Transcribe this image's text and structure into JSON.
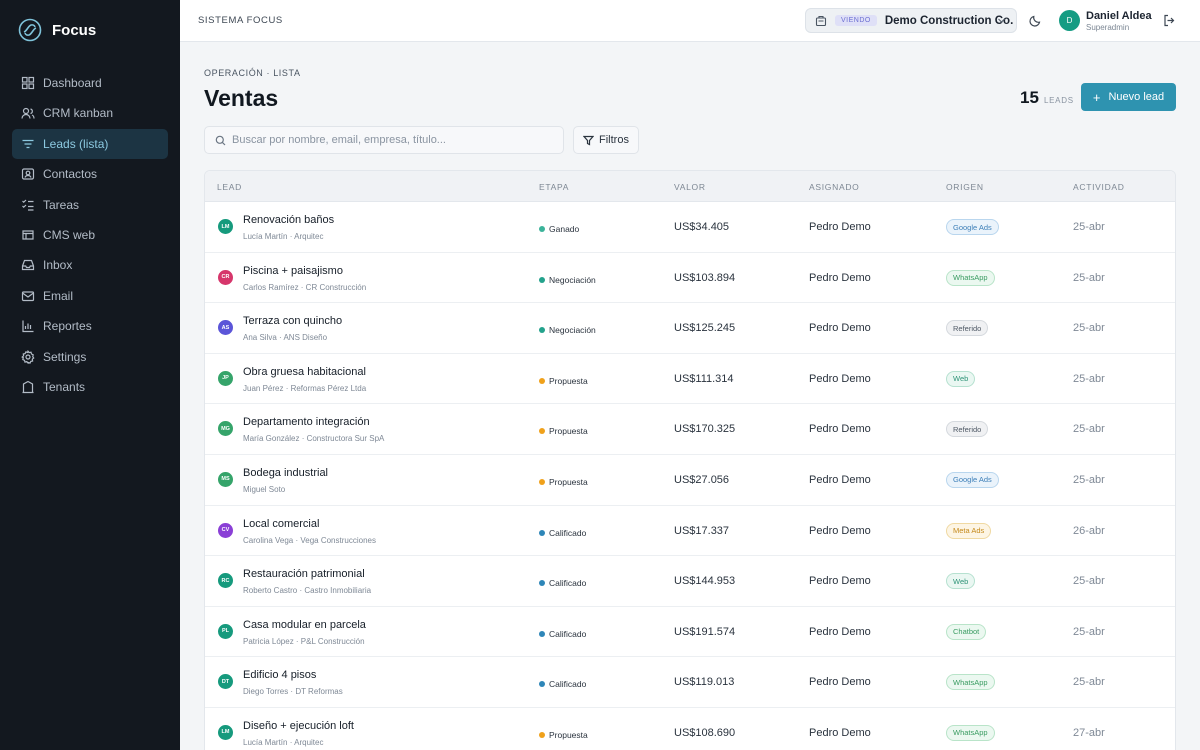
{
  "brand": {
    "name": "Focus"
  },
  "sidebar": {
    "items": [
      {
        "label": "Dashboard",
        "icon": "dashboard-icon"
      },
      {
        "label": "CRM kanban",
        "icon": "users-icon"
      },
      {
        "label": "Leads (lista)",
        "icon": "filter-lines-icon",
        "active": true
      },
      {
        "label": "Contactos",
        "icon": "contact-card-icon"
      },
      {
        "label": "Tareas",
        "icon": "checklist-icon"
      },
      {
        "label": "CMS web",
        "icon": "globe-icon"
      },
      {
        "label": "Inbox",
        "icon": "inbox-icon"
      },
      {
        "label": "Email",
        "icon": "mail-icon"
      },
      {
        "label": "Reportes",
        "icon": "bar-chart-icon"
      },
      {
        "label": "Settings",
        "icon": "gear-icon"
      },
      {
        "label": "Tenants",
        "icon": "building-icon"
      }
    ]
  },
  "topbar": {
    "title": "SISTEMA FOCUS",
    "tenant_badge": "VIENDO",
    "tenant_name": "Demo Construction Co.",
    "user_initial": "D",
    "user_name": "Daniel Aldea",
    "user_role": "Superadmin"
  },
  "header": {
    "breadcrumb": "OPERACIÓN · LISTA",
    "title": "Ventas",
    "count": "15",
    "count_label": "LEADS",
    "new_button": "Nuevo lead"
  },
  "search": {
    "placeholder": "Buscar por nombre, email, empresa, título..."
  },
  "filters": {
    "label": "Filtros"
  },
  "table": {
    "columns": [
      "LEAD",
      "ETAPA",
      "VALOR",
      "ASIGNADO",
      "ORIGEN",
      "ACTIVIDAD"
    ],
    "rows": [
      {
        "initials": "LM",
        "avatar_color": "#169a7d",
        "title": "Renovación baños",
        "subtitle": "Lucía Martín · Arquitec",
        "stage": "Ganado",
        "stage_color": "#3bb39a",
        "value": "US$34.405",
        "assignee": "Pedro Demo",
        "origin": "Google Ads",
        "origin_style": "blue",
        "activity": "25-abr"
      },
      {
        "initials": "CR",
        "avatar_color": "#d6366b",
        "title": "Piscina + paisajismo",
        "subtitle": "Carlos Ramírez · CR Construcción",
        "stage": "Negociación",
        "stage_color": "#23a28c",
        "value": "US$103.894",
        "assignee": "Pedro Demo",
        "origin": "WhatsApp",
        "origin_style": "green",
        "activity": "25-abr"
      },
      {
        "initials": "AS",
        "avatar_color": "#5b55d8",
        "title": "Terraza con quincho",
        "subtitle": "Ana Silva · ANS Diseño",
        "stage": "Negociación",
        "stage_color": "#23a28c",
        "value": "US$125.245",
        "assignee": "Pedro Demo",
        "origin": "Referido",
        "origin_style": "gray",
        "activity": "25-abr"
      },
      {
        "initials": "JP",
        "avatar_color": "#35a46a",
        "title": "Obra gruesa habitacional",
        "subtitle": "Juan Pérez · Reformas Pérez Ltda",
        "stage": "Propuesta",
        "stage_color": "#f0a11b",
        "value": "US$111.314",
        "assignee": "Pedro Demo",
        "origin": "Web",
        "origin_style": "teal",
        "activity": "25-abr"
      },
      {
        "initials": "MG",
        "avatar_color": "#35a46a",
        "title": "Departamento integración",
        "subtitle": "María González · Constructora Sur SpA",
        "stage": "Propuesta",
        "stage_color": "#f0a11b",
        "value": "US$170.325",
        "assignee": "Pedro Demo",
        "origin": "Referido",
        "origin_style": "gray",
        "activity": "25-abr"
      },
      {
        "initials": "MS",
        "avatar_color": "#35a46a",
        "title": "Bodega industrial",
        "subtitle": "Miguel Soto",
        "stage": "Propuesta",
        "stage_color": "#f0a11b",
        "value": "US$27.056",
        "assignee": "Pedro Demo",
        "origin": "Google Ads",
        "origin_style": "blue",
        "activity": "25-abr"
      },
      {
        "initials": "CV",
        "avatar_color": "#8a3fd6",
        "title": "Local comercial",
        "subtitle": "Carolina Vega · Vega Construcciones",
        "stage": "Calificado",
        "stage_color": "#2e86b8",
        "value": "US$17.337",
        "assignee": "Pedro Demo",
        "origin": "Meta Ads",
        "origin_style": "yellow",
        "activity": "26-abr"
      },
      {
        "initials": "RC",
        "avatar_color": "#169a7d",
        "title": "Restauración patrimonial",
        "subtitle": "Roberto Castro · Castro Inmobiliaria",
        "stage": "Calificado",
        "stage_color": "#2e86b8",
        "value": "US$144.953",
        "assignee": "Pedro Demo",
        "origin": "Web",
        "origin_style": "teal",
        "activity": "25-abr"
      },
      {
        "initials": "PL",
        "avatar_color": "#169a7d",
        "title": "Casa modular en parcela",
        "subtitle": "Patricia López · P&L Construcción",
        "stage": "Calificado",
        "stage_color": "#2e86b8",
        "value": "US$191.574",
        "assignee": "Pedro Demo",
        "origin": "Chatbot",
        "origin_style": "green",
        "activity": "25-abr"
      },
      {
        "initials": "DT",
        "avatar_color": "#169a7d",
        "title": "Edificio 4 pisos",
        "subtitle": "Diego Torres · DT Reformas",
        "stage": "Calificado",
        "stage_color": "#2e86b8",
        "value": "US$119.013",
        "assignee": "Pedro Demo",
        "origin": "WhatsApp",
        "origin_style": "green",
        "activity": "25-abr"
      },
      {
        "initials": "LM",
        "avatar_color": "#169a7d",
        "title": "Diseño + ejecución loft",
        "subtitle": "Lucía Martín · Arquitec",
        "stage": "Propuesta",
        "stage_color": "#f0a11b",
        "value": "US$108.690",
        "assignee": "Pedro Demo",
        "origin": "WhatsApp",
        "origin_style": "green",
        "activity": "27-abr"
      }
    ]
  },
  "colors": {
    "accent": "#2e93b0",
    "sidebar_bg": "#13181f",
    "sidebar_active_bg": "#1c3443"
  }
}
